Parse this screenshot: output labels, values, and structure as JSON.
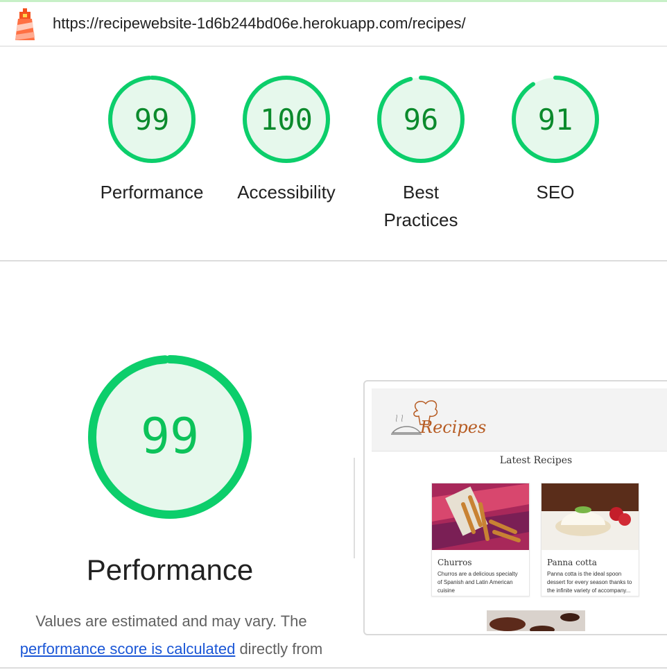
{
  "url_bar": {
    "logo": "lighthouse-logo",
    "url": "https://recipewebsite-1d6b244bd06e.herokuapp.com/recipes/"
  },
  "gauges": [
    {
      "score": 99,
      "label": "Performance"
    },
    {
      "score": 100,
      "label": "Accessibility"
    },
    {
      "score": 96,
      "label": "Best Practices"
    },
    {
      "score": 91,
      "label": "SEO"
    }
  ],
  "performance": {
    "score": 99,
    "title": "Performance",
    "desc_before": "Values are estimated and may vary. The ",
    "link_text": "performance score is calculated",
    "desc_after": " directly from"
  },
  "screenshot": {
    "logo_text": "Recipes",
    "heading": "Latest Recipes",
    "cards": [
      {
        "title": "Churros",
        "text": "Churros are a delicious specialty of Spanish and Latin American cuisine"
      },
      {
        "title": "Panna cotta",
        "text": "Panna cotta is the ideal spoon dessert for every season thanks to the infinite variety of accompany..."
      }
    ]
  },
  "colors": {
    "pass_green": "#0cce6b",
    "pass_fill": "#e6f8ec",
    "score_text": "#0b8a2c",
    "link": "#1a56d6"
  }
}
